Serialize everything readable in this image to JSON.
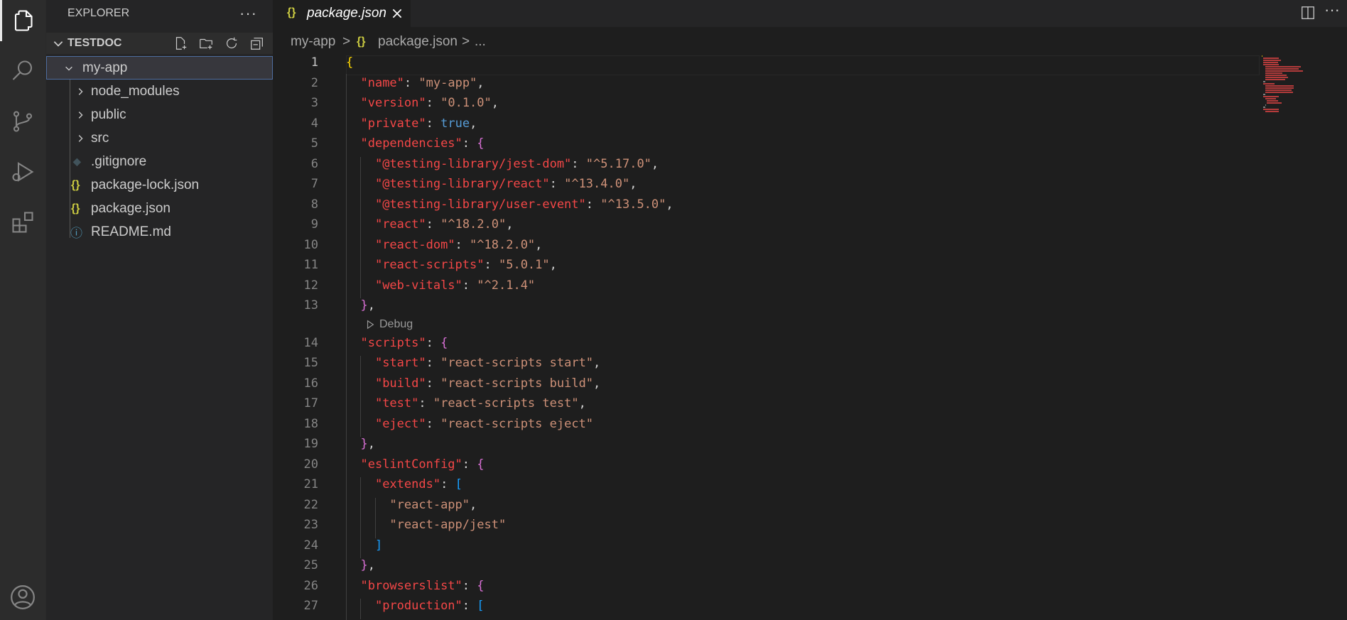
{
  "activity_bar": {
    "items": [
      "files-icon",
      "search-icon",
      "source-control-icon",
      "run-debug-icon",
      "extensions-icon"
    ],
    "account": "account-icon"
  },
  "sidebar": {
    "title": "EXPLORER",
    "more": "···",
    "workspace": "TESTDOC",
    "tree": [
      {
        "label": "my-app",
        "type": "folder-open",
        "icon": ""
      },
      {
        "label": "node_modules",
        "type": "folder",
        "icon": ""
      },
      {
        "label": "public",
        "type": "folder",
        "icon": ""
      },
      {
        "label": "src",
        "type": "folder",
        "icon": ""
      },
      {
        "label": ".gitignore",
        "type": "file",
        "icon": "◆"
      },
      {
        "label": "package-lock.json",
        "type": "file",
        "icon": "{}"
      },
      {
        "label": "package.json",
        "type": "file",
        "icon": "{}"
      },
      {
        "label": "README.md",
        "type": "file",
        "icon": "ⓘ"
      }
    ]
  },
  "tabs": {
    "active": {
      "icon": "{}",
      "label": "package.json",
      "close": "×"
    },
    "more": "···"
  },
  "breadcrumb": {
    "folder": "my-app",
    "sep1": ">",
    "icon": "{}",
    "file": "package.json",
    "sep2": ">",
    "ellipsis": "..."
  },
  "editor": {
    "codelens": "Debug",
    "lines": [
      {
        "n": "1",
        "t": "{"
      },
      {
        "n": "2",
        "t": "  \"name\": \"my-app\","
      },
      {
        "n": "3",
        "t": "  \"version\": \"0.1.0\","
      },
      {
        "n": "4",
        "t": "  \"private\": true,"
      },
      {
        "n": "5",
        "t": "  \"dependencies\": {"
      },
      {
        "n": "6",
        "t": "    \"@testing-library/jest-dom\": \"^5.17.0\","
      },
      {
        "n": "7",
        "t": "    \"@testing-library/react\": \"^13.4.0\","
      },
      {
        "n": "8",
        "t": "    \"@testing-library/user-event\": \"^13.5.0\","
      },
      {
        "n": "9",
        "t": "    \"react\": \"^18.2.0\","
      },
      {
        "n": "10",
        "t": "    \"react-dom\": \"^18.2.0\","
      },
      {
        "n": "11",
        "t": "    \"react-scripts\": \"5.0.1\","
      },
      {
        "n": "12",
        "t": "    \"web-vitals\": \"^2.1.4\""
      },
      {
        "n": "13",
        "t": "  },"
      },
      {
        "n": "14",
        "t": "  \"scripts\": {"
      },
      {
        "n": "15",
        "t": "    \"start\": \"react-scripts start\","
      },
      {
        "n": "16",
        "t": "    \"build\": \"react-scripts build\","
      },
      {
        "n": "17",
        "t": "    \"test\": \"react-scripts test\","
      },
      {
        "n": "18",
        "t": "    \"eject\": \"react-scripts eject\""
      },
      {
        "n": "19",
        "t": "  },"
      },
      {
        "n": "20",
        "t": "  \"eslintConfig\": {"
      },
      {
        "n": "21",
        "t": "    \"extends\": ["
      },
      {
        "n": "22",
        "t": "      \"react-app\","
      },
      {
        "n": "23",
        "t": "      \"react-app/jest\""
      },
      {
        "n": "24",
        "t": "    ]"
      },
      {
        "n": "25",
        "t": "  },"
      },
      {
        "n": "26",
        "t": "  \"browserslist\": {"
      },
      {
        "n": "27",
        "t": "    \"production\": ["
      }
    ]
  },
  "colors": {
    "key": "#f44747",
    "string": "#ce9178",
    "bool": "#569cd6",
    "brace1": "#ffd700",
    "brace2": "#da70d6",
    "brace3": "#179fff"
  }
}
